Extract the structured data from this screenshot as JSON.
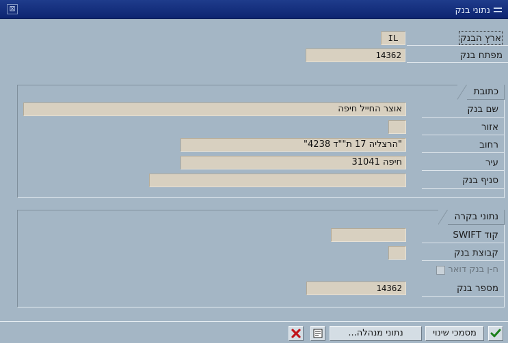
{
  "window": {
    "title": "נתוני בנק",
    "close_glyph": "⊠"
  },
  "header_fields": {
    "bank_country": {
      "label": "ארץ הבנק",
      "value": "IL"
    },
    "bank_key": {
      "label": "מפתח בנק",
      "value": "14362"
    }
  },
  "address": {
    "group_title": "כתובת",
    "bank_name": {
      "label": "שם בנק",
      "value": "אוצר החייל חיפה"
    },
    "region": {
      "label": "אזור",
      "value": ""
    },
    "street": {
      "label": "רחוב",
      "value": "\"הרצליה 17 ת\"\"ד 4238\""
    },
    "city": {
      "label": "עיר",
      "value": "חיפה 31041"
    },
    "bank_branch": {
      "label": "סניף בנק",
      "value": ""
    }
  },
  "control": {
    "group_title": "נתוני בקרה",
    "swift": {
      "label": "קוד SWIFT",
      "value": ""
    },
    "bank_group": {
      "label": "קבוצת בנק",
      "value": ""
    },
    "postbank_account": {
      "label": "ח-ן בנק דואר",
      "checked": false
    },
    "bank_number": {
      "label": "מספר בנק",
      "value": "14362"
    }
  },
  "toolbar": {
    "confirm_icon": "check-icon",
    "change_docs_label": "מסמכי שינוי",
    "admin_data_label": "נתוני מנהלה...",
    "details_icon": "document-icon",
    "cancel_icon": "x-icon"
  },
  "colors": {
    "titlebar": "#0c2470",
    "background": "#a4b6c5",
    "field": "#d8d0c0",
    "confirm_green": "#1a7f1a",
    "cancel_red": "#c0141a"
  }
}
